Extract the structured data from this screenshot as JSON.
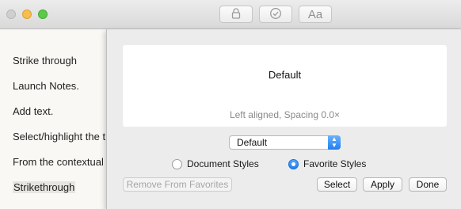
{
  "window": {
    "toolbar": {
      "lock_icon": "lock-icon",
      "check_icon": "checkmark-circle-icon",
      "format_label": "Aa"
    }
  },
  "note": {
    "lines": [
      "Strike through",
      "Launch Notes.",
      "Add text.",
      "Select/highlight the t",
      "From the contextual m",
      "Strikethrough"
    ]
  },
  "style_panel": {
    "preview_title": "Default",
    "preview_subtitle": "Left aligned, Spacing 0.0×",
    "style_select": {
      "value": "Default"
    },
    "radios": {
      "document_styles": {
        "label": "Document Styles",
        "selected": false
      },
      "favorite_styles": {
        "label": "Favorite Styles",
        "selected": true
      }
    },
    "buttons": {
      "remove_favorites": "Remove From Favorites",
      "select": "Select",
      "apply": "Apply",
      "done": "Done"
    }
  },
  "colors": {
    "accent": "#1e7ff1",
    "close": "#cfcfcf",
    "minimize": "#f5be4f",
    "zoom": "#5bc94b"
  }
}
